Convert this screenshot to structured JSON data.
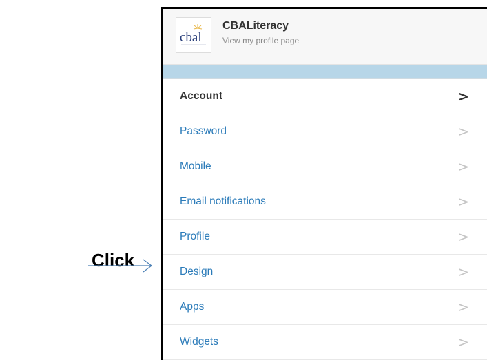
{
  "annotation": {
    "label": "Click"
  },
  "profile": {
    "logo_text": "cbal",
    "name": "CBALiteracy",
    "link": "View my profile page"
  },
  "menu": {
    "items": [
      {
        "label": "Account",
        "active": true
      },
      {
        "label": "Password",
        "active": false
      },
      {
        "label": "Mobile",
        "active": false
      },
      {
        "label": "Email notifications",
        "active": false
      },
      {
        "label": "Profile",
        "active": false
      },
      {
        "label": "Design",
        "active": false
      },
      {
        "label": "Apps",
        "active": false
      },
      {
        "label": "Widgets",
        "active": false
      }
    ],
    "chevron": ">"
  },
  "colors": {
    "link": "#2b7bb9",
    "active": "#333333",
    "band": "#b7d6e8",
    "arrow": "#4a7fb5"
  },
  "icons": {
    "arrow": "right-arrow-icon",
    "chevron": "chevron-right-icon",
    "logo": "cbal-logo"
  }
}
